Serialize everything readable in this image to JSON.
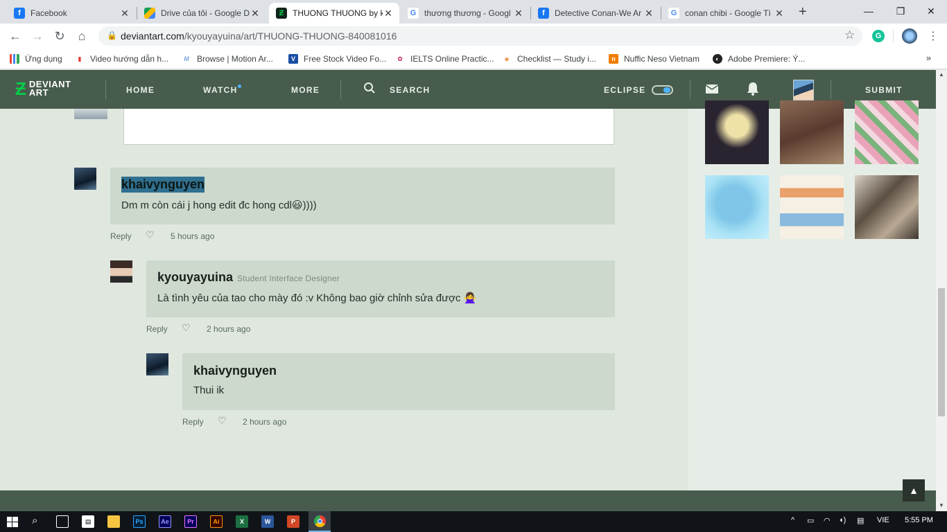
{
  "browser": {
    "tabs": [
      {
        "title": "Facebook",
        "favicon": "facebook-icon"
      },
      {
        "title": "Drive của tôi - Google D",
        "favicon": "google-drive-icon"
      },
      {
        "title": "THUONG THUONG by k",
        "favicon": "deviantart-icon"
      },
      {
        "title": "thương thương - Googl",
        "favicon": "google-icon"
      },
      {
        "title": "Detective Conan-We Ar",
        "favicon": "facebook-icon"
      },
      {
        "title": "conan chibi - Google Tì",
        "favicon": "google-icon"
      }
    ],
    "url_domain": "deviantart.com",
    "url_path": "/kyouyayuina/art/THUONG-THUONG-840081016",
    "bookmarks": [
      {
        "label": "Ứng dụng",
        "icon": "apps-grid-icon"
      },
      {
        "label": "Video hướng dẫn h...",
        "icon": "video-icon"
      },
      {
        "label": "Browse | Motion Ar...",
        "icon": "motion-array-icon"
      },
      {
        "label": "Free Stock Video Fo...",
        "icon": "videvo-icon"
      },
      {
        "label": "IELTS Online Practic...",
        "icon": "ielts-icon"
      },
      {
        "label": "Checklist — Study i...",
        "icon": "checklist-icon"
      },
      {
        "label": "Nuffic Neso Vietnam",
        "icon": "nuffic-icon"
      },
      {
        "label": "Adobe Premiere: Ý...",
        "icon": "adobe-icon"
      }
    ]
  },
  "da_nav": {
    "logo": "DEVIANT ART",
    "home": "HOME",
    "watch": "WATCH",
    "more": "MORE",
    "search": "SEARCH",
    "eclipse": "ECLIPSE",
    "submit": "SUBMIT"
  },
  "comments": [
    {
      "author": "khaivynguyen",
      "text": "Dm m còn cái j hong edit đc hong cdl😃))))",
      "reply_label": "Reply",
      "time": "5 hours ago"
    },
    {
      "author": "kyouyayuina",
      "title": "Student Interface Designer",
      "text": "Là tình yêu của tao cho mày đó :v Không bao giờ chỉnh sửa được 🙅‍♀️",
      "reply_label": "Reply",
      "time": "2 hours ago"
    },
    {
      "author": "khaivynguyen",
      "text": "Thui ik",
      "reply_label": "Reply",
      "time": "2 hours ago"
    }
  ],
  "taskbar": {
    "lang": "VIE",
    "time": "5:55 PM"
  },
  "colors": {
    "nav": "#475c4d",
    "bubble": "#ccd9cc",
    "background": "#dfe7df",
    "accent": "#05cc47"
  }
}
